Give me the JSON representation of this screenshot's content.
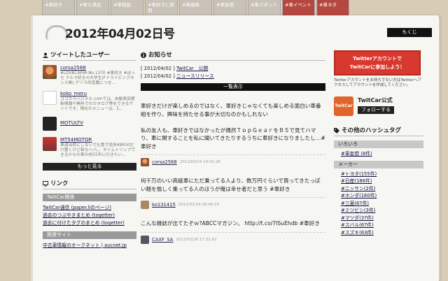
{
  "tabs": [
    "#車好き",
    "#車も満足",
    "#車相談",
    "#車好きに質問",
    "#車画像",
    "#車妄想",
    "#車スポット",
    "#車イベント",
    "#車ネタ"
  ],
  "issue_title": "2012年04月02日号",
  "mokuji": "もくじ",
  "users_section": {
    "title": "ツイートしたユーザー",
    "users": [
      {
        "name": "corsa2568",
        "desc": "#LDVBCAR伊-No.1370 #車好き #ぼっち クルマ好きの大学生(Fドライビングセンス無) ゲリラ改変魔につき…"
      },
      {
        "name": "koko_meru",
        "desc": "ココカラハジメル.comでは、自動車部更新情報や無料でのカタログ等をできるサイトです。現在のメニューは、【…"
      },
      {
        "name": "MOTULTV",
        "desc": ""
      },
      {
        "name": "MT54MOTOR",
        "desc": "車道出荷にしないでも雪で雨多68R30だけ置くけど新なハパ。、タイムトリップできるかなの車の約55年に行きたい…"
      }
    ],
    "more": "もっと見る"
  },
  "links_section": {
    "title": "リンク",
    "group1": "TwitCar関係",
    "links1": [
      "TwitCar通信 (paper.liのページ)",
      "過去のつぶやきまとめ (togetter)",
      "過去に付けたタグのまとめ (togetter)"
    ],
    "group2": "関連サイト",
    "links2": [
      "中古車情報のオークネット | aucnet.jp"
    ]
  },
  "news_section": {
    "title": "お知らせ",
    "items": [
      {
        "date": "[ 2012/04/02 ]",
        "link": "TwitCar　公開"
      },
      {
        "date": "[ 2012/04/02 ]",
        "link": "ニュースリリース"
      }
    ],
    "list_button": "一覧表示"
  },
  "tweets": [
    {
      "text": "車好きだけが楽しめるのではなく、車好きじゃなくても楽しめる面白い車番組を作り、興味を持たせる事が大切なのかもしれない\n\n私の友人も、車好きではなかったが偶然ＴｏｐＧｅａｒをＢＳで見てハマり、車に関することを私に聞いてきたりするうちに車好きになりましたし…#車好き",
      "user": "corsa2568",
      "time": "2012/03/24 10:55:28"
    },
    {
      "text": "何千万のいい高級車にただ乗ってる人より、数万円ぐらいで買ってきたっぽい軽を愉しく乗ってる人のほうが俺は幸せ者だと思う #車好き",
      "user": "ko131415",
      "time": "2012/03/24 18:46:14"
    },
    {
      "text": "こんな雑誌が出てたぞｗ?ABCCマガジン。 http://t.co/7ISuEhdb #車好き",
      "user": "CAXF_SA",
      "time": "2012/03/26 17:31:02"
    }
  ],
  "right": {
    "banner_line1": "Twitterアカウントで",
    "banner_line2": "TwitCarに参加しよう！",
    "banner_note": "Twitterアカウントをお持ちでない方はTwitterへアクセスしてアカウントを作成してください。",
    "official_title": "TwitCar公式",
    "logo_text": "TwitCar",
    "follow": "フォローする",
    "hashtag_title": "その他のハッシュタグ",
    "group1": "いろいろ",
    "tags1": [
      "#車妄想 (8件)"
    ],
    "group2": "メーカー",
    "tags2": [
      "#トヨタ(155件)",
      "#日産(186件)",
      "#ニッサン(2件)",
      "#ホンダ(160件)",
      "#三菱(67件)",
      "#ミツビシ(3件)",
      "#マツダ(37件)",
      "#スバル(67件)",
      "#スズキ(63件)"
    ]
  },
  "colors": {
    "tab_red": "#b54740",
    "banner_red": "#d8382e",
    "twitcar_orange": "#e1642a"
  }
}
